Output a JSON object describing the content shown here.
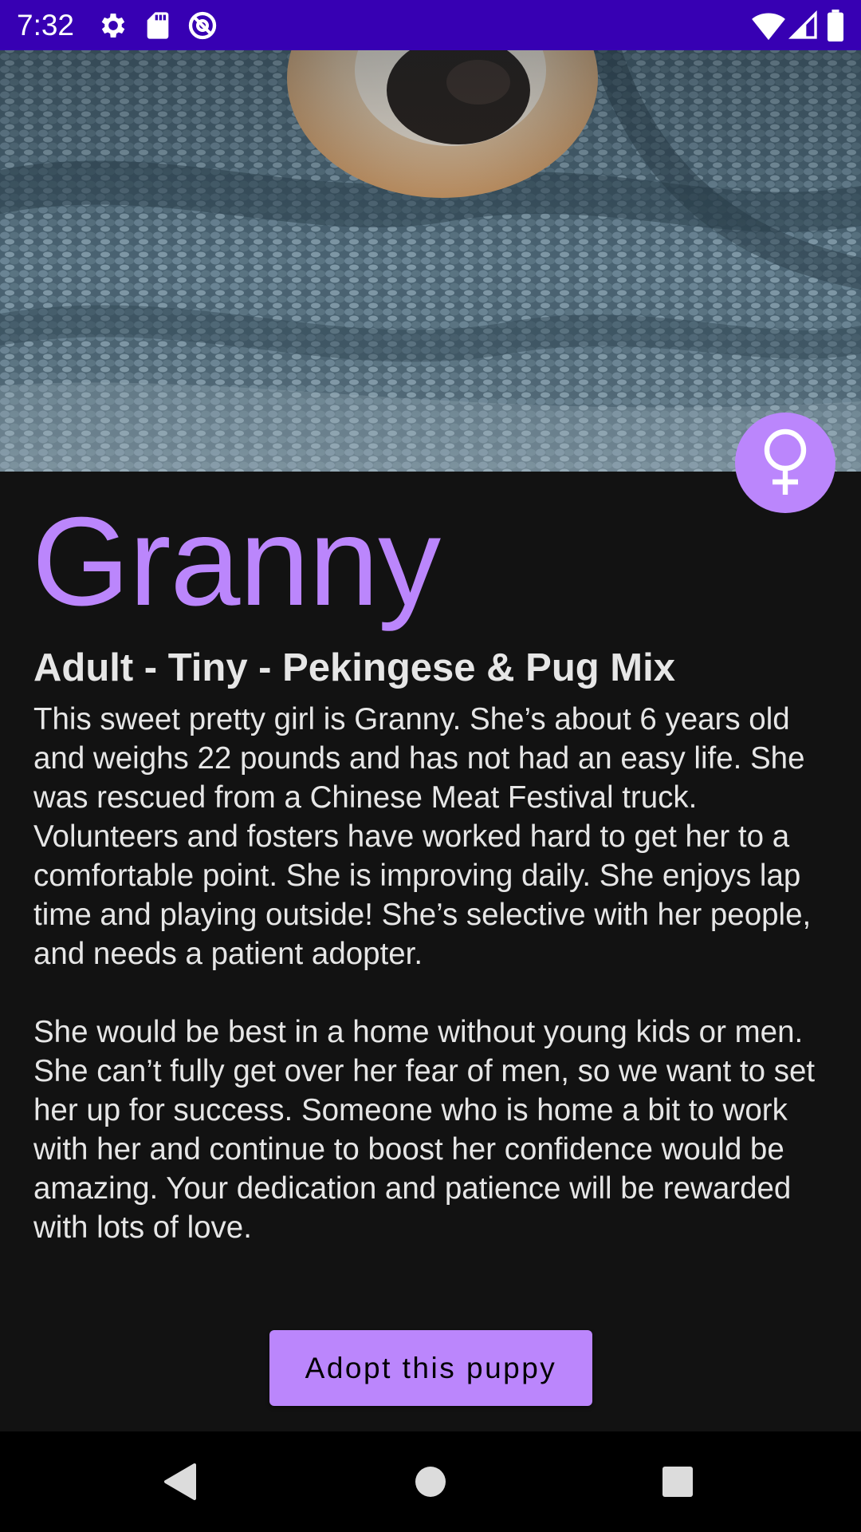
{
  "status_bar": {
    "time": "7:32",
    "background": "#3700b3",
    "left_icons": [
      "gear-icon",
      "sd-card-icon",
      "data-saver-icon"
    ],
    "right_icons": [
      "wifi-icon",
      "cell-signal-icon",
      "battery-icon"
    ]
  },
  "hero": {
    "image": "dog-wrapped-in-knit-blanket"
  },
  "pet": {
    "gender_icon": "female-icon",
    "name": "Granny",
    "subtitle": "Adult - Tiny - Pekingese & Pug Mix",
    "description_paragraph_1": "This sweet pretty girl is Granny. She’s about 6 years old and weighs 22 pounds and has not had an easy life. She was rescued from a Chinese Meat Festival truck. Volunteers and fosters have worked hard to get her to a comfortable point. She is improving daily. She enjoys lap time and playing outside! She’s selective with her people, and needs a patient adopter.",
    "description_paragraph_2": "She would be best in a home without young kids or men. She can’t fully get over her fear of men, so we want to set her up for success. Someone who is home a bit to work with her and continue to boost her confidence would be amazing. Your dedication and patience will be rewarded with lots of love."
  },
  "actions": {
    "adopt_label": "Adopt this puppy"
  },
  "nav_bar": {
    "buttons": [
      "back-icon",
      "home-icon",
      "recents-icon"
    ]
  },
  "colors": {
    "accent": "#bb86fc",
    "background": "#121212",
    "status_bar": "#3700b3",
    "text": "#e6e6e6"
  }
}
